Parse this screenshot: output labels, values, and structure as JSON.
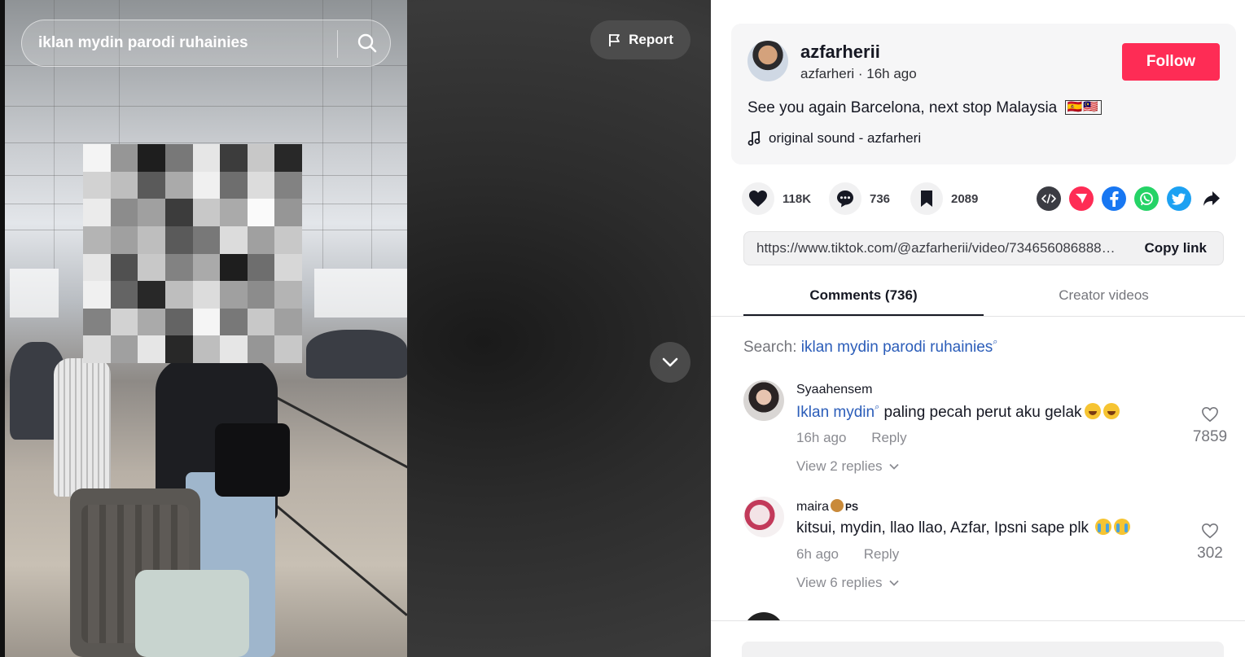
{
  "video": {
    "search_query": "iklan mydin parodi ruhainies",
    "report_label": "Report"
  },
  "author": {
    "display_name": "azfarherii",
    "username": "azfarheri",
    "time_ago": "16h ago",
    "follow_label": "Follow",
    "caption": "See you again Barcelona, next stop Malaysia",
    "caption_flags": "🇪🇸🇲🇾",
    "sound": "original sound - azfarheri"
  },
  "stats": {
    "likes": "118K",
    "comments": "736",
    "saves": "2089"
  },
  "share_icons": [
    "embed-icon",
    "send-to-friends-icon",
    "facebook-icon",
    "whatsapp-icon",
    "twitter-icon",
    "share-arrow-icon"
  ],
  "share_colors": {
    "embed": "#3b3c43",
    "send": "#fe2c55",
    "facebook": "#1877f2",
    "whatsapp": "#25d366",
    "twitter": "#1da1f2"
  },
  "link": {
    "url": "https://www.tiktok.com/@azfarherii/video/7346560868888888888",
    "copy_label": "Copy link"
  },
  "tabs": {
    "comments": "Comments (736)",
    "creator_videos": "Creator videos"
  },
  "comment_search": {
    "prefix": "Search: ",
    "keyword": "iklan mydin parodi ruhainies"
  },
  "comments": [
    {
      "user": "Syaahensem",
      "keyword": "Iklan mydin",
      "text": " paling pecah perut aku gelak",
      "time": "16h ago",
      "reply_label": "Reply",
      "view_replies": "View 2 replies",
      "likes": "7859"
    },
    {
      "user": "maira",
      "user_badge": "PS",
      "text": "kitsui, mydin, llao llao, Azfar, Ipsni sape plk",
      "time": "6h ago",
      "reply_label": "Reply",
      "view_replies": "View 6 replies",
      "likes": "302"
    }
  ],
  "colors": {
    "brand_red": "#fe2c55",
    "link_blue": "#2b5db9",
    "text_primary": "#161823",
    "text_muted": "#8a8b91"
  }
}
